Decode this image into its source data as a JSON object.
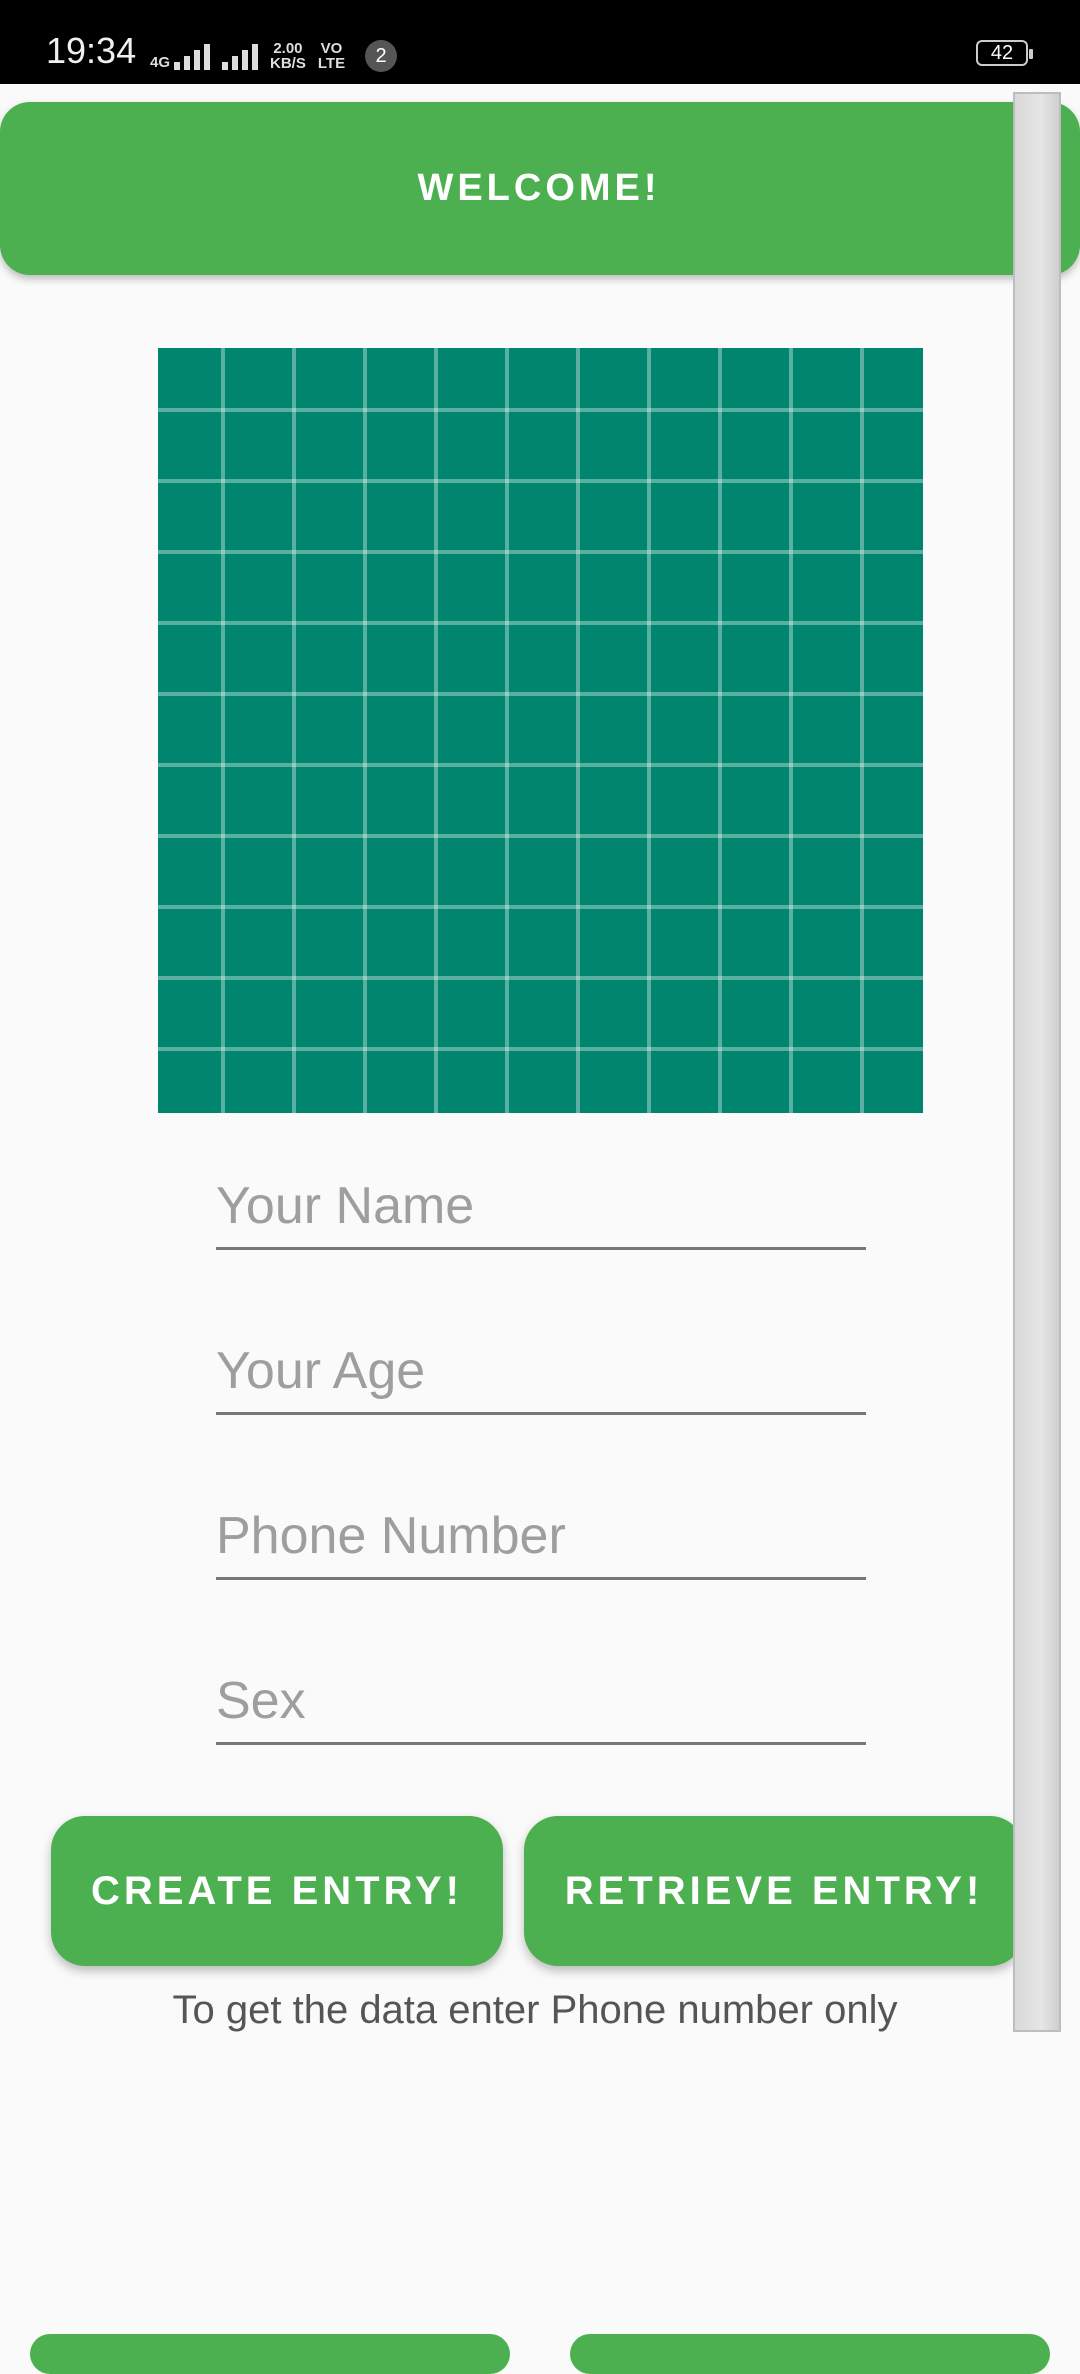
{
  "status_bar": {
    "time": "19:34",
    "network": "4G",
    "speed_value": "2.00",
    "speed_unit": "KB/S",
    "volte_top": "VO",
    "volte_bottom": "LTE",
    "notification_count": "2",
    "battery": "42"
  },
  "header": {
    "title": "WELCOME!"
  },
  "form": {
    "name_placeholder": "Your Name",
    "age_placeholder": "Your Age",
    "phone_placeholder": "Phone Number",
    "sex_placeholder": "Sex"
  },
  "actions": {
    "create_label": "CREATE ENTRY!",
    "retrieve_label": "RETRIEVE ENTRY!"
  },
  "hint": "To get the data enter Phone number only",
  "colors": {
    "accent": "#4caf50",
    "image_bg": "#00856f",
    "status_bar": "#000000"
  }
}
